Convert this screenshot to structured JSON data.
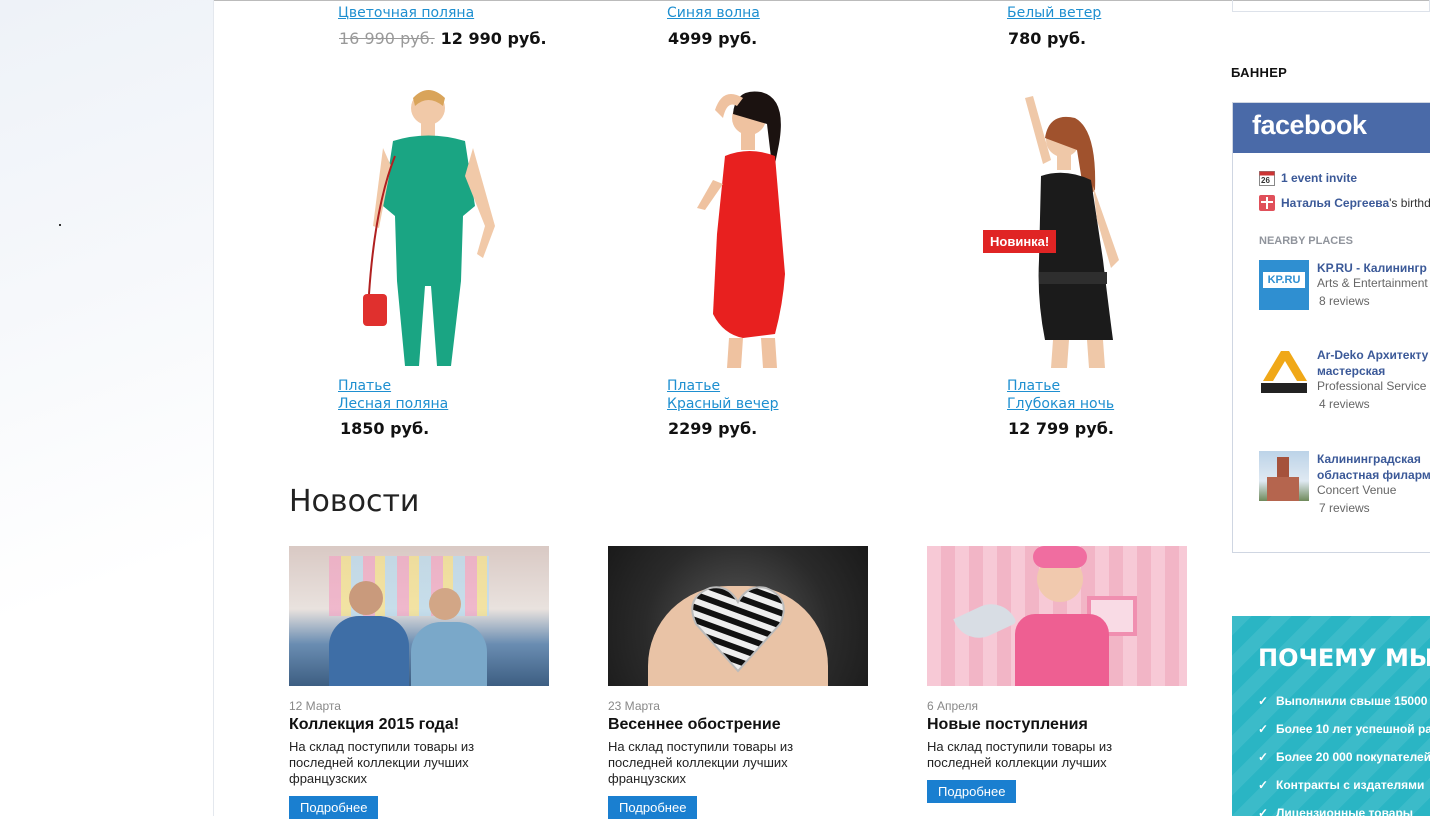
{
  "products_top": [
    {
      "name": "Цветочная поляна",
      "old_price": "16 990 руб.",
      "price": "12 990 руб."
    },
    {
      "name": "Синяя волна",
      "price": "4999 руб."
    },
    {
      "name": "Белый ветер",
      "price": "780 руб."
    }
  ],
  "products": [
    {
      "type": "Платье",
      "name": "Лесная поляна",
      "price": "1850 руб.",
      "color": "#1aa583"
    },
    {
      "type": "Платье",
      "name": "Красный вечер",
      "price": "2299 руб.",
      "color": "#e8201f"
    },
    {
      "type": "Платье",
      "name": "Глубокая ночь",
      "price": "12 799 руб.",
      "color": "#1b1b1b",
      "badge": "Новинка!"
    }
  ],
  "news": {
    "title": "Новости",
    "items": [
      {
        "date": "12 Марта",
        "headline": "Коллекция 2015 года!",
        "text": "На склад поступили товары из последней коллекции лучших французских",
        "button": "Подробнее"
      },
      {
        "date": "23 Марта",
        "headline": "Весеннее обострение",
        "text": "На склад поступили товары из последней коллекции лучших французских",
        "button": "Подробнее"
      },
      {
        "date": "6 Апреля",
        "headline": "Новые поступления",
        "text": "На склад поступили товары из последней коллекции лучших",
        "button": "Подробнее"
      }
    ]
  },
  "sidebar": {
    "banner_label": "БАННЕР",
    "facebook": {
      "logo": "facebook",
      "event_day": "26",
      "event_invite": "1 event invite",
      "birthday_name": "Наталья Сергеева",
      "birthday_suffix": "'s birthd",
      "nearby_label": "NEARBY PLACES",
      "places": [
        {
          "name": "KP.RU - Калинингр",
          "category": "Arts & Entertainment",
          "reviews": "8 reviews"
        },
        {
          "name": "Ar-Deko Архитекту",
          "name2": "мастерская",
          "category": "Professional Service",
          "reviews": "4 reviews"
        },
        {
          "name": "Калининградская",
          "name2": "областная филарм",
          "category": "Concert Venue",
          "reviews": "7 reviews"
        }
      ]
    },
    "why": {
      "title": "ПОЧЕМУ МЫ?",
      "items": [
        "Выполнили свыше 15000",
        "Более 10 лет успешной ра",
        "Более 20 000 покупателей",
        "Контракты с издателями",
        "Лицензионные товары"
      ]
    }
  }
}
